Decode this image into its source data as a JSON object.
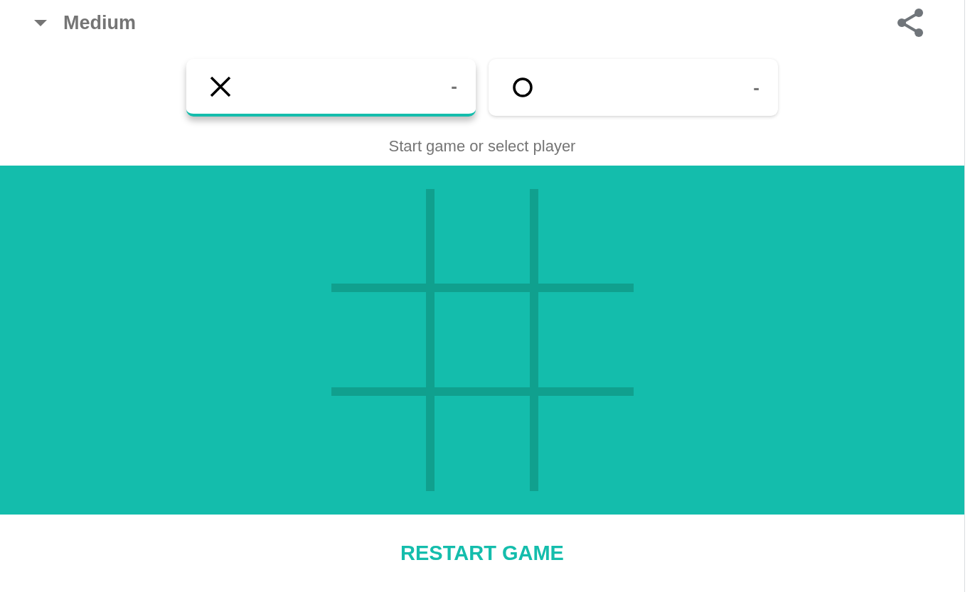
{
  "difficulty": {
    "label": "Medium"
  },
  "players": [
    {
      "kind": "x",
      "score": "-",
      "selected": true
    },
    {
      "kind": "o",
      "score": "-",
      "selected": false
    }
  ],
  "status": "Start game or select player",
  "restart_button": "RESTART GAME"
}
